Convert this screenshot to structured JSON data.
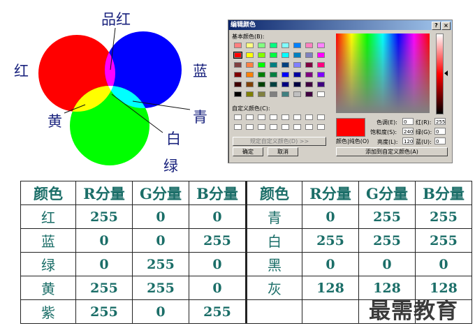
{
  "diagram": {
    "labels": {
      "magenta": "品红",
      "red": "红",
      "blue": "蓝",
      "cyan": "青",
      "yellow": "黄",
      "white": "白",
      "green": "绿"
    },
    "colors": {
      "red": "#ff0000",
      "green": "#00ff00",
      "blue": "#0000ff"
    }
  },
  "dialog": {
    "title": "编辑颜色",
    "help_button": "?",
    "close_button": "×",
    "basic_colors_label": "基本颜色(B):",
    "basic_colors": [
      [
        "#ff8080",
        "#ffff80",
        "#80ff80",
        "#00ff80",
        "#80ffff",
        "#0080ff",
        "#ff80c0",
        "#ff80ff"
      ],
      [
        "#ff0000",
        "#ffff00",
        "#80ff00",
        "#00ff40",
        "#00ffff",
        "#0080c0",
        "#8080c0",
        "#ff00ff"
      ],
      [
        "#804040",
        "#ff8040",
        "#00ff00",
        "#008080",
        "#004080",
        "#8080ff",
        "#800040",
        "#ff0080"
      ],
      [
        "#800000",
        "#ff8000",
        "#008000",
        "#008040",
        "#0000ff",
        "#0000a0",
        "#800080",
        "#8000ff"
      ],
      [
        "#400000",
        "#804000",
        "#004000",
        "#004040",
        "#000080",
        "#000040",
        "#400040",
        "#400080"
      ],
      [
        "#000000",
        "#808000",
        "#808040",
        "#808080",
        "#408080",
        "#c0c0c0",
        "#400040",
        "#ffffff"
      ]
    ],
    "custom_colors_label": "自定义颜色(C):",
    "define_custom_button": "规定自定义颜色(D) >>",
    "ok_button": "确定",
    "cancel_button": "取消",
    "color_solid_label": "颜色|纯色(O)",
    "hue_label": "色调(E):",
    "hue_value": "0",
    "sat_label": "饱和度(S):",
    "sat_value": "240",
    "lum_label": "亮度(L):",
    "lum_value": "120",
    "red_label": "红(R):",
    "red_value": "255",
    "green_label": "绿(G):",
    "green_value": "0",
    "blue_label": "蓝(U):",
    "blue_value": "0",
    "add_custom_button": "添加到自定义颜色(A)",
    "preview_color": "#ff0000"
  },
  "table": {
    "headers": [
      "颜色",
      "R分量",
      "G分量",
      "B分量",
      "颜色",
      "R分量",
      "G分量",
      "B分量"
    ],
    "rows": [
      [
        "红",
        "255",
        "0",
        "0",
        "青",
        "0",
        "255",
        "255"
      ],
      [
        "蓝",
        "0",
        "0",
        "255",
        "白",
        "255",
        "255",
        "255"
      ],
      [
        "绿",
        "0",
        "255",
        "0",
        "黑",
        "0",
        "0",
        "0"
      ],
      [
        "黄",
        "255",
        "255",
        "0",
        "灰",
        "128",
        "128",
        "128"
      ],
      [
        "紫",
        "255",
        "0",
        "255",
        "",
        "",
        "",
        ""
      ]
    ]
  },
  "watermark": "最需教育"
}
